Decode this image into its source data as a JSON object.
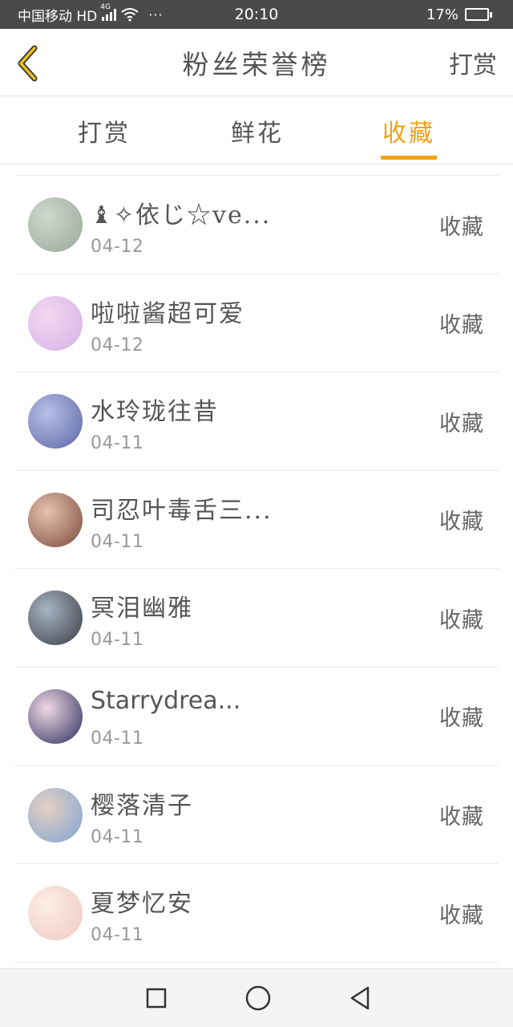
{
  "status_bar": {
    "carrier": "中国移动 HD",
    "network": "4G",
    "more": "···",
    "time": "20:10",
    "battery": "17%",
    "battery_level": 0.17
  },
  "header": {
    "title": "粉丝荣誉榜",
    "right_action": "打赏",
    "back_icon": "chevron-left-icon"
  },
  "colors": {
    "accent": "#f2a216",
    "text": "#555555",
    "muted": "#999999"
  },
  "tabs": [
    {
      "label": "打赏",
      "active": false
    },
    {
      "label": "鲜花",
      "active": false
    },
    {
      "label": "收藏",
      "active": true
    }
  ],
  "fans": [
    {
      "name": "♝✧依じ☆ve...",
      "date": "04-12",
      "action": "收藏",
      "avatar_colors": [
        "#9aa79b",
        "#cfd8cc"
      ]
    },
    {
      "name": "啦啦酱超可爱",
      "date": "04-12",
      "action": "收藏",
      "avatar_colors": [
        "#d7b2e6",
        "#f2d7f0"
      ]
    },
    {
      "name": "水玲珑往昔",
      "date": "04-11",
      "action": "收藏",
      "avatar_colors": [
        "#5b66a8",
        "#b7c0e6"
      ]
    },
    {
      "name": "司忍叶毒舌三...",
      "date": "04-11",
      "action": "收藏",
      "avatar_colors": [
        "#7a4a3a",
        "#e6c1b0"
      ]
    },
    {
      "name": "冥泪幽雅",
      "date": "04-11",
      "action": "收藏",
      "avatar_colors": [
        "#3b3c45",
        "#a6b4c2"
      ]
    },
    {
      "name": "Starrydrea...",
      "date": "04-11",
      "action": "收藏",
      "avatar_colors": [
        "#2a2d5c",
        "#f0d8e4"
      ]
    },
    {
      "name": "樱落清子",
      "date": "04-11",
      "action": "收藏",
      "avatar_colors": [
        "#7fa4d2",
        "#e4d0c4"
      ]
    },
    {
      "name": "夏梦忆安",
      "date": "04-11",
      "action": "收藏",
      "avatar_colors": [
        "#f0c8c4",
        "#fbeee6"
      ]
    }
  ],
  "nav": {
    "recents": "square-icon",
    "home": "circle-icon",
    "back": "triangle-back-icon"
  }
}
